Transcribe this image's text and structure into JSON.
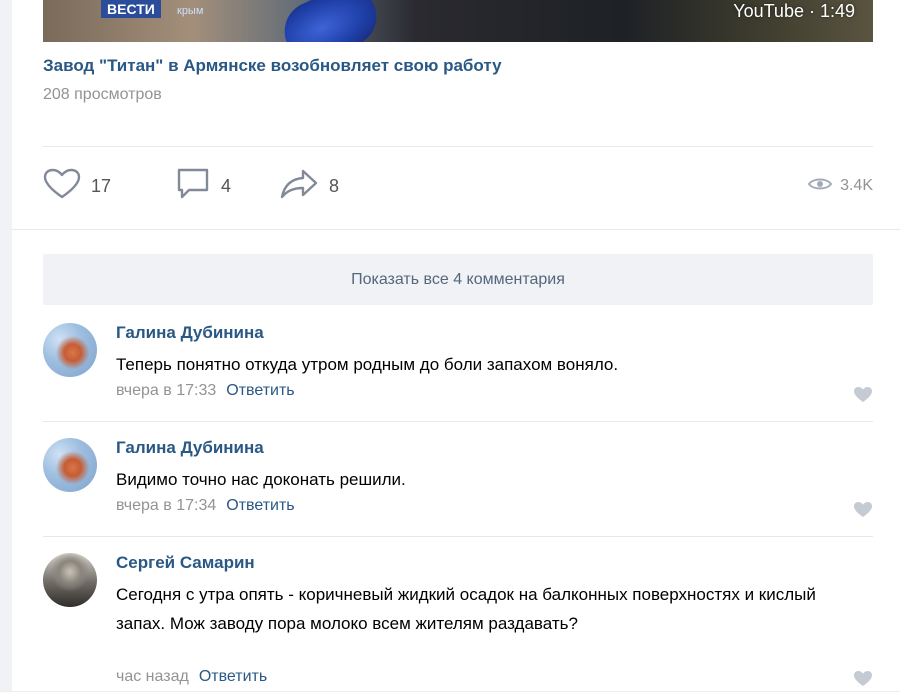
{
  "video": {
    "channel_logo": "ВЕСТИ",
    "channel_sub": "КРЫМ",
    "badge": "YouTube · 1:49"
  },
  "post": {
    "title": "Завод \"Титан\" в Армянске возобновляет свою работу",
    "views_text": "208 просмотров"
  },
  "actions": {
    "likes": "17",
    "comments": "4",
    "shares": "8",
    "views": "3.4K",
    "icons": [
      "heart-icon",
      "comment-icon",
      "share-icon",
      "eye-icon"
    ]
  },
  "show_all_label": "Показать все 4 комментария",
  "comments": [
    {
      "author": "Галина Дубинина",
      "text": "Теперь понятно откуда утром родным до боли запахом воняло.",
      "time": "вчера в 17:33",
      "reply": "Ответить"
    },
    {
      "author": "Галина Дубинина",
      "text": "Видимо точно нас доконать решили.",
      "time": "вчера в 17:34",
      "reply": "Ответить"
    },
    {
      "author": "Сергей Самарин",
      "text": "Сегодня с утра опять - коричневый жидкий осадок на балконных поверхностях и кислый запах. Мож заводу пора молоко всем жителям раздавать?",
      "time": "час назад",
      "reply": "Ответить"
    }
  ],
  "colors": {
    "link": "#2a5885",
    "muted": "#939393",
    "icon": "#828a99",
    "button_bg": "#f0f2f5"
  }
}
